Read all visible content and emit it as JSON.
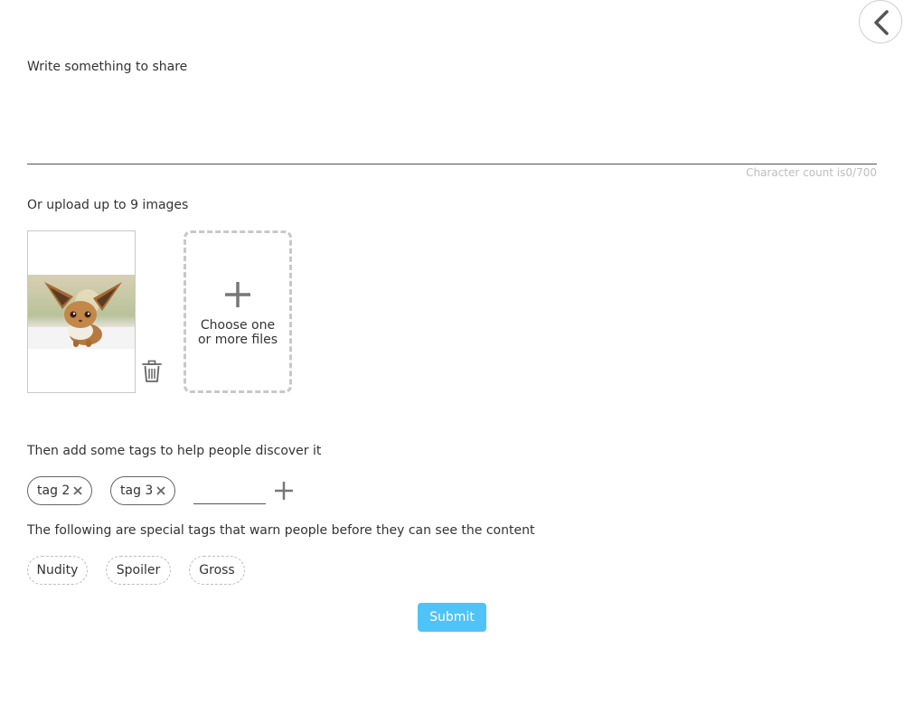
{
  "nav": {
    "back_icon": "chevron-left-icon"
  },
  "post": {
    "text_label": "Write something to share",
    "text_value": "",
    "char_count_prefix": "Character count is",
    "char_count_value": "0/700"
  },
  "upload": {
    "label": "Or upload up to 9 images",
    "images": [
      {
        "icon": "eevee-photo"
      }
    ],
    "delete_icon": "trash-icon",
    "add_icon": "plus-icon",
    "add_label_line1": "Choose one",
    "add_label_line2": "or more files"
  },
  "tags": {
    "label": "Then add some tags to help people discover it",
    "items": [
      {
        "label": "tag 2"
      },
      {
        "label": "tag 3"
      }
    ],
    "remove_icon": "close-icon",
    "input_value": "",
    "add_icon": "plus-icon"
  },
  "special_tags": {
    "label": "The following are special tags that warn people before they can see the content",
    "items": [
      {
        "label": "Nudity"
      },
      {
        "label": "Spoiler"
      },
      {
        "label": "Gross"
      }
    ]
  },
  "submit_label": "Submit",
  "colors": {
    "accent": "#4fc3f7",
    "border": "#c8c8c8",
    "text": "#333333",
    "muted": "#bdbdbd"
  }
}
